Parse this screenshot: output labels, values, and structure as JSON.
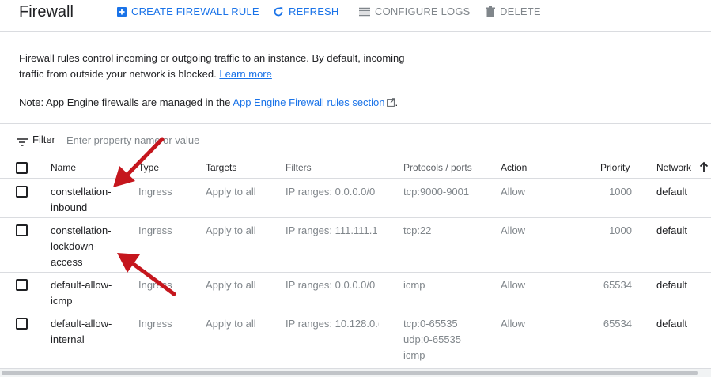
{
  "header": {
    "title": "Firewall",
    "create_label": "CREATE FIREWALL RULE",
    "refresh_label": "REFRESH",
    "configure_logs_label": "CONFIGURE LOGS",
    "delete_label": "DELETE"
  },
  "description": {
    "text": "Firewall rules control incoming or outgoing traffic to an instance. By default, incoming traffic from outside your network is blocked.",
    "learn_more": "Learn more",
    "note_prefix": "Note: App Engine firewalls are managed in the",
    "note_link": "App Engine Firewall rules section",
    "note_suffix": "."
  },
  "filter": {
    "label": "Filter",
    "placeholder": "Enter property name or value"
  },
  "table": {
    "columns": {
      "name": "Name",
      "type": "Type",
      "targets": "Targets",
      "filters": "Filters",
      "protocols": "Protocols / ports",
      "action": "Action",
      "priority": "Priority",
      "network": "Network"
    },
    "sorted_column": "Network",
    "sort_direction": "ascending",
    "rows": [
      {
        "name_lines": [
          "constellation-",
          "inbound"
        ],
        "type": "Ingress",
        "targets": "Apply to all",
        "filters": "IP ranges: 0.0.0.0/0",
        "protocols": [
          "tcp:9000-9001"
        ],
        "action": "Allow",
        "priority": "1000",
        "network": "default"
      },
      {
        "name_lines": [
          "constellation-",
          "lockdown-",
          "access"
        ],
        "type": "Ingress",
        "targets": "Apply to all",
        "filters": "IP ranges: 111.111.1",
        "protocols": [
          "tcp:22"
        ],
        "action": "Allow",
        "priority": "1000",
        "network": "default"
      },
      {
        "name_lines": [
          "default-allow-",
          "icmp"
        ],
        "type": "Ingress",
        "targets": "Apply to all",
        "filters": "IP ranges: 0.0.0.0/0",
        "protocols": [
          "icmp"
        ],
        "action": "Allow",
        "priority": "65534",
        "network": "default"
      },
      {
        "name_lines": [
          "default-allow-",
          "internal"
        ],
        "type": "Ingress",
        "targets": "Apply to all",
        "filters": "IP ranges: 10.128.0.(",
        "protocols": [
          "tcp:0-65535",
          "udp:0-65535",
          "icmp"
        ],
        "action": "Allow",
        "priority": "65534",
        "network": "default"
      }
    ]
  },
  "colors": {
    "accent": "#1a73e8",
    "annotation_arrow": "#c5161d",
    "divider": "#dadce0",
    "muted_text": "#80868b"
  },
  "icons": {
    "create": "plus-box-icon",
    "refresh": "refresh-icon",
    "configure_logs": "list-lines-icon",
    "delete": "trash-icon",
    "filter": "filter-lines-icon",
    "external": "external-link-icon",
    "sort": "arrow-up-icon"
  }
}
